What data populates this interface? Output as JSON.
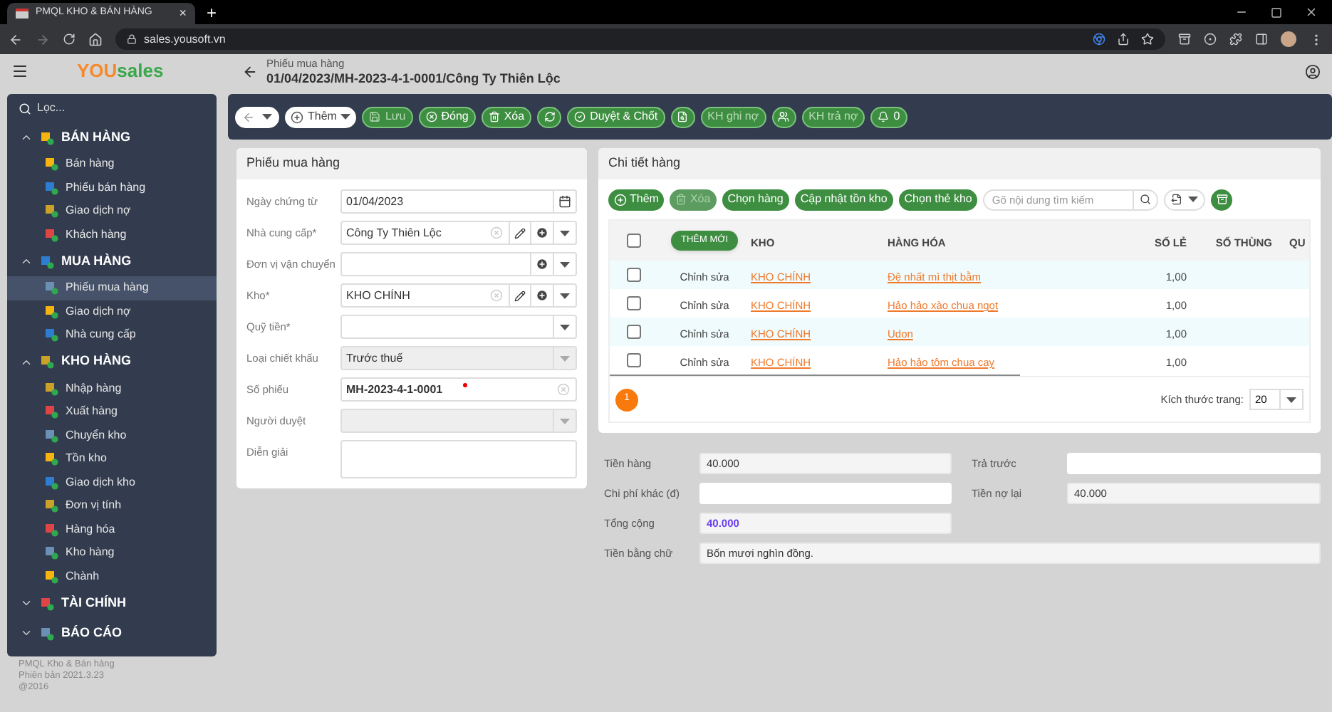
{
  "browser": {
    "tab_title": "PMQL KHO & BÁN HÀNG",
    "tab_close": "×",
    "new_tab": "+",
    "url": "sales.yousoft.vn"
  },
  "header": {
    "logo_accent": "YOU",
    "logo_rest": "sales",
    "breadcrumb": "Phiếu mua hàng",
    "title": "01/04/2023/MH-2023-4-1-0001/Công Ty Thiên Lộc"
  },
  "sidebar": {
    "filter_placeholder": "Lọc...",
    "sections": [
      {
        "label": "BÁN HÀNG",
        "expanded": true,
        "items": [
          {
            "label": "Bán hàng",
            "selected": false
          },
          {
            "label": "Phiếu bán hàng",
            "selected": false
          },
          {
            "label": "Giao dịch nợ",
            "selected": false
          },
          {
            "label": "Khách hàng",
            "selected": false
          }
        ]
      },
      {
        "label": "MUA HÀNG",
        "expanded": true,
        "items": [
          {
            "label": "Phiếu mua hàng",
            "selected": true
          },
          {
            "label": "Giao dịch nợ",
            "selected": false
          },
          {
            "label": "Nhà cung cấp",
            "selected": false
          }
        ]
      },
      {
        "label": "KHO HÀNG",
        "expanded": true,
        "items": [
          {
            "label": "Nhập hàng",
            "selected": false
          },
          {
            "label": "Xuất hàng",
            "selected": false
          },
          {
            "label": "Chuyển kho",
            "selected": false
          },
          {
            "label": "Tồn kho",
            "selected": false
          },
          {
            "label": "Giao dịch kho",
            "selected": false
          },
          {
            "label": "Đơn vị tính",
            "selected": false
          },
          {
            "label": "Hàng hóa",
            "selected": false
          },
          {
            "label": "Kho hàng",
            "selected": false
          },
          {
            "label": "Chành",
            "selected": false
          }
        ]
      },
      {
        "label": "TÀI CHÍNH",
        "expanded": false
      },
      {
        "label": "BÁO CÁO",
        "expanded": false
      }
    ],
    "footer": [
      "PMQL Kho & Bán hàng",
      "Phiên bản 2021.3.23",
      "@2016"
    ]
  },
  "toolbar": [
    {
      "kind": "nav",
      "disabled": false
    },
    {
      "kind": "split",
      "label": "Thêm",
      "disabled": false
    },
    {
      "kind": "button",
      "label": "Lưu",
      "disabled": true
    },
    {
      "kind": "button",
      "label": "Đóng",
      "disabled": false
    },
    {
      "kind": "button",
      "label": "Xóa",
      "disabled": false
    },
    {
      "kind": "icon",
      "disabled": false
    },
    {
      "kind": "button",
      "label": "Duyệt & Chốt",
      "disabled": false
    },
    {
      "kind": "icon",
      "disabled": false
    },
    {
      "kind": "text",
      "label": "KH ghi nợ",
      "disabled": true
    },
    {
      "kind": "icon",
      "disabled": false
    },
    {
      "kind": "text",
      "label": "KH trả nợ",
      "disabled": true
    },
    {
      "kind": "button",
      "label": "0",
      "disabled": false
    }
  ],
  "form": {
    "title": "Phiếu mua hàng",
    "fields": [
      {
        "label": "Ngày chứng từ",
        "kind": "date",
        "value": "01/04/2023",
        "disabled": false
      },
      {
        "label": "Nhà cung cấp*",
        "kind": "combo",
        "value": "Công Ty Thiên Lộc",
        "clear": true,
        "edit": true,
        "add": true,
        "dropdown": true,
        "disabled": false
      },
      {
        "label": "Đơn vị vận chuyển",
        "kind": "combo",
        "add": true,
        "dropdown": true,
        "disabled": false
      },
      {
        "label": "Kho*",
        "kind": "combo",
        "value": "KHO CHÍNH",
        "clear": true,
        "edit": true,
        "add": true,
        "dropdown": true,
        "disabled": false
      },
      {
        "label": "Quỹ tiền*",
        "kind": "combo",
        "dropdown": true,
        "disabled": false
      },
      {
        "label": "Loại chiết khấu",
        "kind": "combo",
        "value": "Trước thuế",
        "dropdown": true,
        "disabled": true
      },
      {
        "label": "Số phiếu",
        "kind": "combo",
        "value": "MH-2023-4-1-0001",
        "clear": true,
        "bold": true,
        "required_dot": true,
        "disabled": false
      },
      {
        "label": "Người duyệt",
        "kind": "combo",
        "dropdown": true,
        "disabled": true
      },
      {
        "label": "Diễn giải",
        "kind": "textarea",
        "disabled": false
      }
    ]
  },
  "detail": {
    "title": "Chi tiết hàng",
    "buttons": [
      {
        "label": "Thêm",
        "disabled": false
      },
      {
        "label": "Xóa",
        "disabled": true
      },
      {
        "label": "Chọn hàng",
        "disabled": false
      },
      {
        "label": "Cập nhật tồn kho",
        "disabled": false
      },
      {
        "label": "Chọn thẻ kho",
        "disabled": false
      }
    ],
    "search_placeholder": "Gõ nội dung tìm kiếm",
    "select_all_checked": false,
    "add_new": "THÊM MỚI",
    "columns": [
      "KHO",
      "HÀNG HÓA",
      "SỐ LẺ",
      "SỐ THÙNG",
      "QU"
    ],
    "rows": [
      {
        "checked": false,
        "edit": "Chỉnh sửa",
        "kho": "KHO CHÍNH",
        "hang_hoa": "Đệ nhất mì thịt bằm",
        "so_le": "1,00"
      },
      {
        "checked": false,
        "edit": "Chỉnh sửa",
        "kho": "KHO CHÍNH",
        "hang_hoa": "Hảo hảo xào chua ngọt",
        "so_le": "1,00"
      },
      {
        "checked": false,
        "edit": "Chỉnh sửa",
        "kho": "KHO CHÍNH",
        "hang_hoa": "Udon",
        "so_le": "1,00"
      },
      {
        "checked": false,
        "edit": "Chỉnh sửa",
        "kho": "KHO CHÍNH",
        "hang_hoa": "Hảo hảo tôm chua cay",
        "so_le": "1,00"
      }
    ],
    "pages": [
      {
        "label": "1",
        "selected": true
      }
    ],
    "page_size_label": "Kích thước trang:",
    "page_size": "20"
  },
  "totals": [
    [
      {
        "label": "Tiền hàng",
        "value": "40.000",
        "readonly": true,
        "emphasis": false
      },
      {
        "label": "Trả trước",
        "readonly": false
      }
    ],
    [
      {
        "label": "Chi phí khác (đ)",
        "readonly": false
      },
      {
        "label": "Tiền nợ lại",
        "value": "40.000",
        "readonly": true,
        "emphasis": false
      }
    ],
    [
      {
        "label": "Tổng cộng",
        "value": "40.000",
        "readonly": true,
        "emphasis": true
      }
    ]
  ],
  "amount_in_words": {
    "label": "Tiền bằng chữ",
    "value": "Bốn mươi nghìn đồng."
  }
}
